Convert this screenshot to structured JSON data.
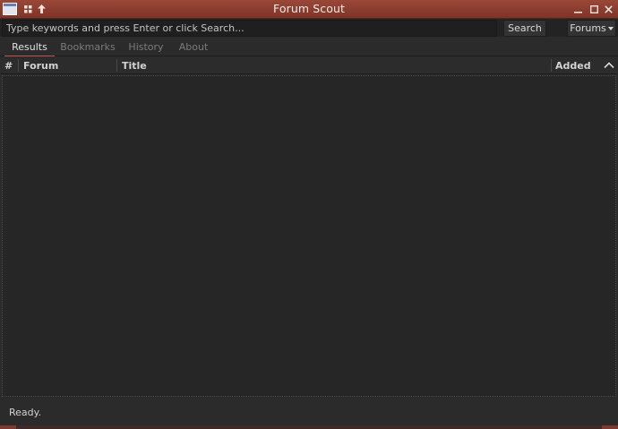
{
  "window": {
    "title": "Forum Scout",
    "icons": [
      "app-window-icon",
      "grid-icon",
      "arrow-up-icon",
      "minimize-icon",
      "maximize-icon",
      "close-icon"
    ],
    "accent_color": "#8b3e30"
  },
  "search": {
    "placeholder": "Type keywords and press Enter or click Search...",
    "value": "",
    "search_label": "Search",
    "forums_label": "Forums"
  },
  "tabs": [
    {
      "label": "Results",
      "active": true
    },
    {
      "label": "Bookmarks",
      "active": false
    },
    {
      "label": "History",
      "active": false
    },
    {
      "label": "About",
      "active": false
    }
  ],
  "table": {
    "columns": [
      "#",
      "Forum",
      "Title",
      "Added"
    ],
    "sort": "ascending",
    "rows": []
  },
  "status": {
    "text": "Ready."
  }
}
